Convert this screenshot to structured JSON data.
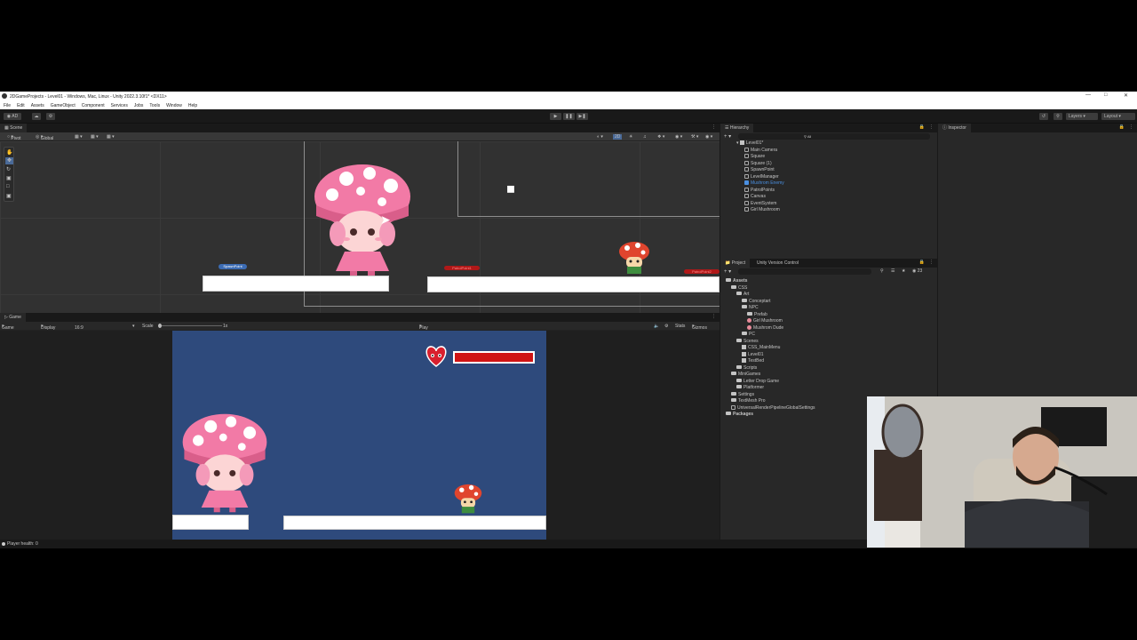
{
  "window": {
    "title": "2DGameProjects - Level01 - Windows, Mac, Linux - Unity 2022.3.10f1* <DX11>"
  },
  "menu": [
    "File",
    "Edit",
    "Assets",
    "GameObject",
    "Component",
    "Services",
    "Jobs",
    "Tools",
    "Window",
    "Help"
  ],
  "toolbar": {
    "account": "AD",
    "layers": "Layers",
    "layout": "Layout"
  },
  "scene": {
    "tab": "Scene",
    "pivot": "Pivot",
    "global": "Global",
    "mode2d": "2D",
    "labels": {
      "spawn": "SpawnPoint",
      "patrol1": "PatrolPoint1",
      "patrol2": "PatrolPoint2"
    }
  },
  "game": {
    "tab": "Game",
    "mode": "Game",
    "display": "Display 1",
    "aspect": "16:9 Aspect",
    "scale_label": "Scale",
    "scale_value": "1x",
    "play_focused": "Play Focused",
    "stats": "Stats",
    "gizmos": "Gizmos",
    "health_fraction": 1.0
  },
  "hierarchy": {
    "tab": "Hierarchy",
    "search_placeholder": "All",
    "scene": "Level01*",
    "items": [
      "Main Camera",
      "Square",
      "Square (1)",
      "SpawnPoint",
      "LevelManager",
      "Mushrom Enemy",
      "PatrolPoints",
      "Canvas",
      "EventSystem",
      "Girl Mushroom"
    ]
  },
  "inspector": {
    "tab": "Inspector"
  },
  "project": {
    "tab": "Project",
    "tab2": "Unity Version Control",
    "count": "23",
    "tree": [
      {
        "label": "Assets",
        "depth": 0,
        "kind": "folder-bold"
      },
      {
        "label": "CSS",
        "depth": 1,
        "kind": "folder"
      },
      {
        "label": "Art",
        "depth": 2,
        "kind": "folder"
      },
      {
        "label": "Conceptart",
        "depth": 3,
        "kind": "folder"
      },
      {
        "label": "NPC",
        "depth": 3,
        "kind": "folder"
      },
      {
        "label": "Prefab",
        "depth": 4,
        "kind": "folder"
      },
      {
        "label": "Girl Mushroom",
        "depth": 4,
        "kind": "prefab"
      },
      {
        "label": "Mushrom Dude",
        "depth": 4,
        "kind": "prefab"
      },
      {
        "label": "PC",
        "depth": 3,
        "kind": "folder"
      },
      {
        "label": "Scenes",
        "depth": 2,
        "kind": "folder"
      },
      {
        "label": "CSS_MainMenu",
        "depth": 3,
        "kind": "scene"
      },
      {
        "label": "Level01",
        "depth": 3,
        "kind": "scene"
      },
      {
        "label": "TestBed",
        "depth": 3,
        "kind": "scene"
      },
      {
        "label": "Scripts",
        "depth": 2,
        "kind": "folder"
      },
      {
        "label": "MiniGames",
        "depth": 1,
        "kind": "folder"
      },
      {
        "label": "Letter Drop Game",
        "depth": 2,
        "kind": "folder"
      },
      {
        "label": "Platformer",
        "depth": 2,
        "kind": "folder"
      },
      {
        "label": "Settings",
        "depth": 1,
        "kind": "folder"
      },
      {
        "label": "TextMesh Pro",
        "depth": 1,
        "kind": "folder"
      },
      {
        "label": "UniversalRenderPipelineGlobalSettings",
        "depth": 1,
        "kind": "asset"
      },
      {
        "label": "Packages",
        "depth": 0,
        "kind": "folder-bold"
      }
    ]
  },
  "status": {
    "message": "Player health: 0"
  },
  "colors": {
    "pink": "#f27aa6",
    "health_red": "#d01414",
    "game_bg": "#2e4a7c",
    "selected_blue": "#4a90e2"
  }
}
